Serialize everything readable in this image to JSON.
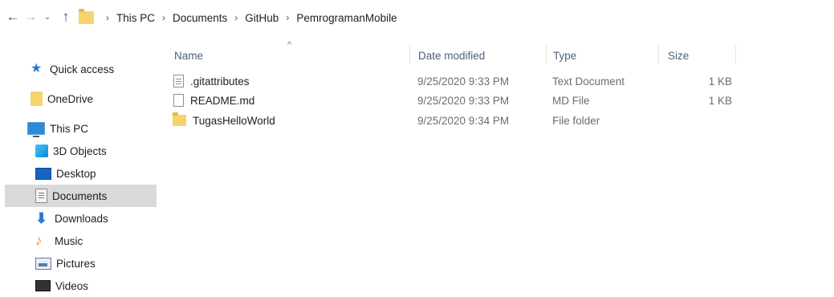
{
  "navigation": {
    "back_icon": "arrow-left-icon",
    "forward_icon": "arrow-right-icon",
    "recent_icon": "chevron-down-icon",
    "up_icon": "arrow-up-icon",
    "back_glyph": "←",
    "forward_glyph": "→",
    "recent_glyph": "⌄",
    "up_glyph": "↑"
  },
  "address_bar": {
    "separator": "›",
    "crumbs": [
      "This PC",
      "Documents",
      "GitHub",
      "PemrogramanMobile"
    ]
  },
  "sidebar": {
    "items": [
      {
        "label": "Quick access",
        "icon": "star-icon"
      },
      {
        "label": "OneDrive",
        "icon": "onedrive-folder-icon"
      },
      {
        "label": "This PC",
        "icon": "computer-icon"
      },
      {
        "label": "3D Objects",
        "icon": "cube-icon"
      },
      {
        "label": "Desktop",
        "icon": "desktop-icon"
      },
      {
        "label": "Documents",
        "icon": "documents-icon",
        "selected": true
      },
      {
        "label": "Downloads",
        "icon": "download-arrow-icon"
      },
      {
        "label": "Music",
        "icon": "music-note-icon"
      },
      {
        "label": "Pictures",
        "icon": "pictures-icon"
      },
      {
        "label": "Videos",
        "icon": "videos-icon"
      }
    ]
  },
  "file_list": {
    "sort_glyph": "^",
    "columns": {
      "name": "Name",
      "date": "Date modified",
      "type": "Type",
      "size": "Size"
    },
    "rows": [
      {
        "name": ".gitattributes",
        "date": "9/25/2020 9:33 PM",
        "type": "Text Document",
        "size": "1 KB",
        "icon": "text-file-icon"
      },
      {
        "name": "README.md",
        "date": "9/25/2020 9:33 PM",
        "type": "MD File",
        "size": "1 KB",
        "icon": "file-icon"
      },
      {
        "name": "TugasHelloWorld",
        "date": "9/25/2020 9:34 PM",
        "type": "File folder",
        "size": "",
        "icon": "folder-icon"
      }
    ]
  },
  "colors": {
    "selection": "#d9d9d9",
    "header_text": "#4c607a",
    "folder": "#f8d26c",
    "accent_blue": "#2b79d3"
  }
}
